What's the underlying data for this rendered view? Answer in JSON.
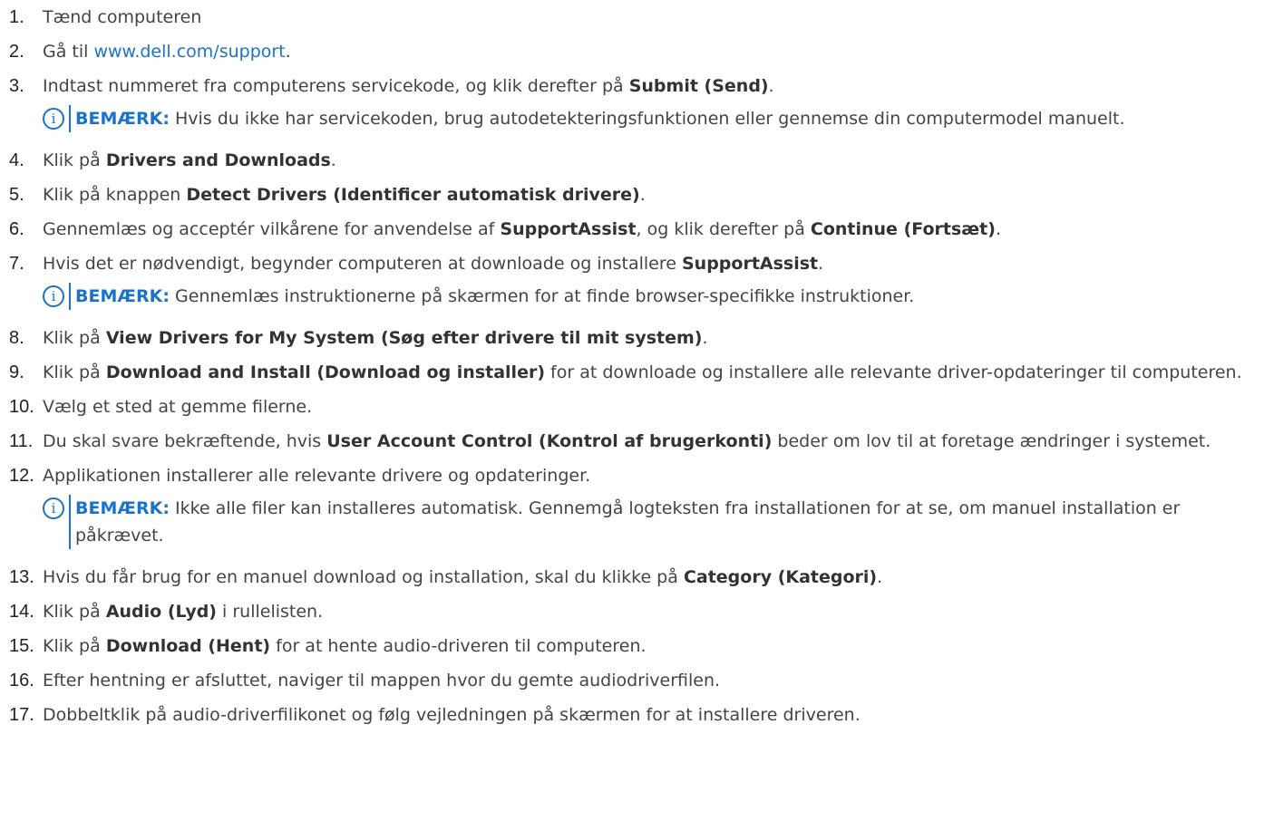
{
  "steps": [
    {
      "n": "1.",
      "parts": [
        {
          "t": "Tænd computeren"
        }
      ]
    },
    {
      "n": "2.",
      "parts": [
        {
          "t": "Gå til "
        },
        {
          "t": "www.dell.com/support",
          "link": true
        },
        {
          "t": "."
        }
      ]
    },
    {
      "n": "3.",
      "parts": [
        {
          "t": "Indtast nummeret fra computerens servicekode, og klik derefter på "
        },
        {
          "t": "Submit (Send)",
          "bold": true
        },
        {
          "t": "."
        }
      ],
      "note": {
        "label": "BEMÆRK:",
        "text": " Hvis du ikke har servicekoden, brug autodetekteringsfunktionen eller gennemse din computermodel manuelt."
      }
    },
    {
      "n": "4.",
      "parts": [
        {
          "t": "Klik på "
        },
        {
          "t": "Drivers and Downloads",
          "bold": true
        },
        {
          "t": "."
        }
      ]
    },
    {
      "n": "5.",
      "parts": [
        {
          "t": "Klik på knappen "
        },
        {
          "t": "Detect Drivers (Identificer automatisk drivere)",
          "bold": true
        },
        {
          "t": "."
        }
      ]
    },
    {
      "n": "6.",
      "parts": [
        {
          "t": "Gennemlæs og acceptér vilkårene for anvendelse af "
        },
        {
          "t": "SupportAssist",
          "bold": true
        },
        {
          "t": ", og klik derefter på "
        },
        {
          "t": "Continue (Fortsæt)",
          "bold": true
        },
        {
          "t": "."
        }
      ]
    },
    {
      "n": "7.",
      "parts": [
        {
          "t": "Hvis det er nødvendigt, begynder computeren at downloade og installere "
        },
        {
          "t": "SupportAssist",
          "bold": true
        },
        {
          "t": "."
        }
      ],
      "note": {
        "label": "BEMÆRK:",
        "text": " Gennemlæs instruktionerne på skærmen for at finde browser-specifikke instruktioner."
      }
    },
    {
      "n": "8.",
      "parts": [
        {
          "t": "Klik på "
        },
        {
          "t": "View Drivers for My System (Søg efter drivere til mit system)",
          "bold": true
        },
        {
          "t": "."
        }
      ]
    },
    {
      "n": "9.",
      "parts": [
        {
          "t": "Klik på "
        },
        {
          "t": "Download and Install (Download og installer)",
          "bold": true
        },
        {
          "t": " for at downloade og installere alle relevante driver-opdateringer til computeren."
        }
      ]
    },
    {
      "n": "10.",
      "parts": [
        {
          "t": "Vælg et sted at gemme filerne."
        }
      ]
    },
    {
      "n": "11.",
      "parts": [
        {
          "t": "Du skal svare bekræftende, hvis "
        },
        {
          "t": "User Account Control (Kontrol af brugerkonti)",
          "bold": true
        },
        {
          "t": " beder om lov til at foretage ændringer i systemet."
        }
      ]
    },
    {
      "n": "12.",
      "parts": [
        {
          "t": "Applikationen installerer alle relevante drivere og opdateringer."
        }
      ],
      "note": {
        "label": "BEMÆRK:",
        "text": " Ikke alle filer kan installeres automatisk. Gennemgå logteksten fra installationen for at se, om manuel installation er påkrævet."
      }
    },
    {
      "n": "13.",
      "parts": [
        {
          "t": "Hvis du får brug for en manuel download og installation, skal du klikke på "
        },
        {
          "t": "Category (Kategori)",
          "bold": true
        },
        {
          "t": "."
        }
      ]
    },
    {
      "n": "14.",
      "parts": [
        {
          "t": "Klik på "
        },
        {
          "t": "Audio (Lyd)",
          "bold": true
        },
        {
          "t": " i rullelisten."
        }
      ]
    },
    {
      "n": "15.",
      "parts": [
        {
          "t": "Klik på "
        },
        {
          "t": "Download (Hent)",
          "bold": true
        },
        {
          "t": " for at hente audio-driveren til computeren."
        }
      ]
    },
    {
      "n": "16.",
      "parts": [
        {
          "t": "Efter hentning er afsluttet, naviger til mappen hvor du gemte audiodriverfilen."
        }
      ]
    },
    {
      "n": "17.",
      "parts": [
        {
          "t": "Dobbeltklik på audio-driverfilikonet og følg vejledningen på skærmen for at installere driveren."
        }
      ]
    }
  ],
  "note_icon": "info-icon",
  "colors": {
    "accent": "#1a73c9",
    "text": "#444444"
  }
}
